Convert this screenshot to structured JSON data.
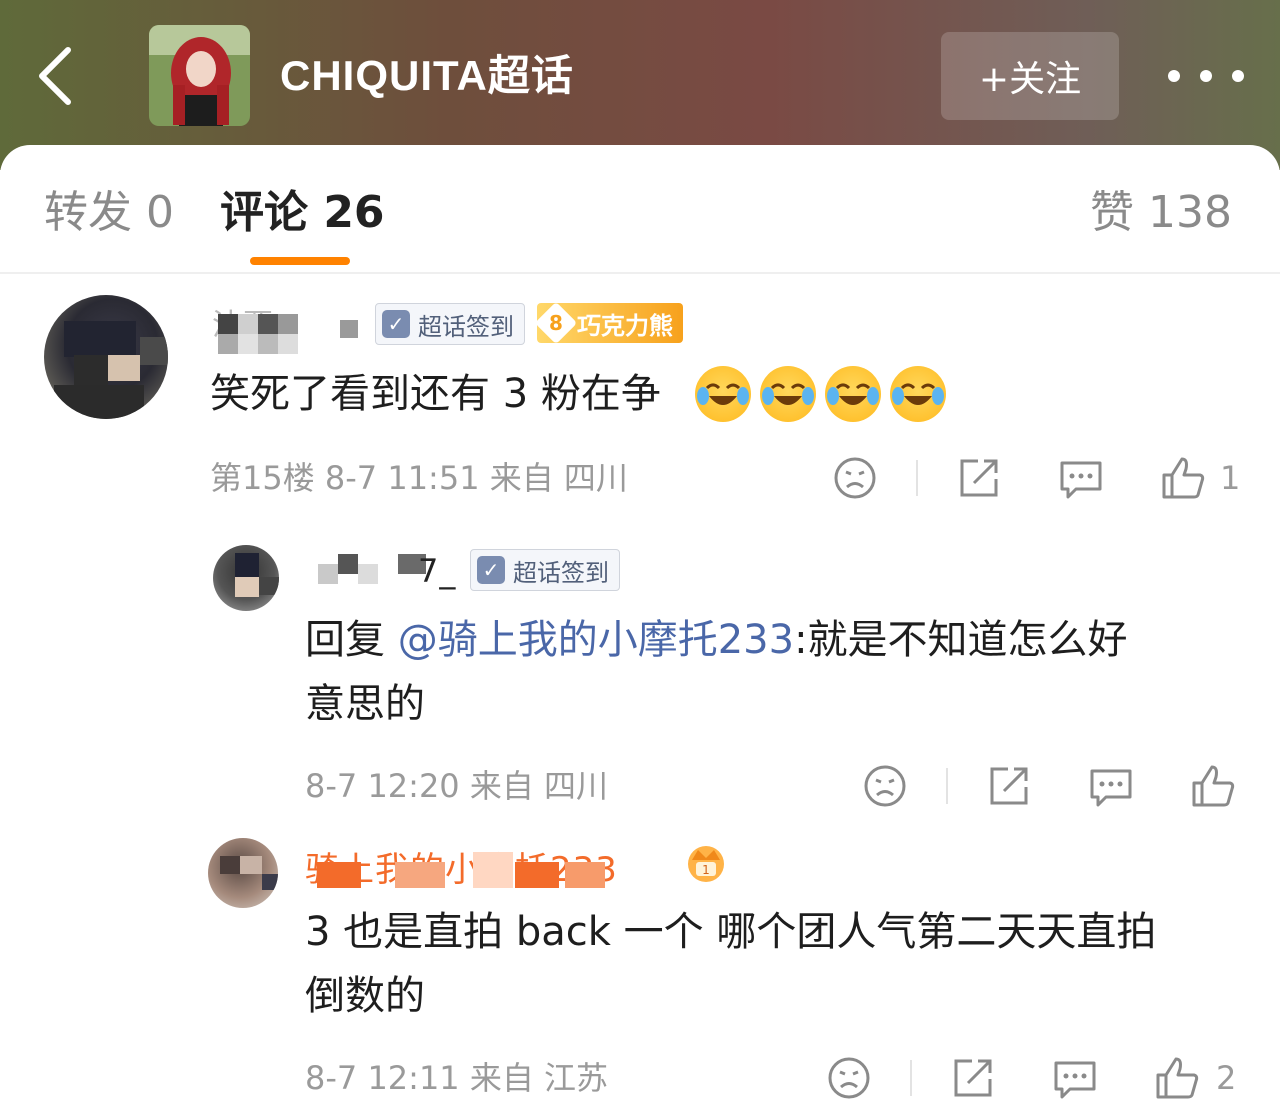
{
  "header": {
    "title": "CHIQUITA超话",
    "follow_label": "+关注",
    "back_icon": "back-arrow-icon",
    "more_icon": "more-dots-icon"
  },
  "tabs": {
    "repost": "转发 0",
    "comment": "评论 26",
    "like": "赞 138"
  },
  "colors": {
    "accent": "#ff8200",
    "mention": "#4a67a8",
    "username_highlight": "#f36b2a"
  },
  "comments": [
    {
      "username": "沫栗",
      "badges": {
        "checkin": "超话签到",
        "fan_level": "8",
        "fan_name": "巧克力熊"
      },
      "text": "笑死了看到还有 3 粉在争",
      "meta": "第15楼 8-7 11:51 来自 四川",
      "likes": "1"
    },
    {
      "username": "7_",
      "badges": {
        "checkin": "超话签到"
      },
      "reply_prefix": "回复 ",
      "mention": "@骑上我的小摩托233",
      "text_line1": ":就是不知道怎么好",
      "text_line2": "意思的",
      "meta": "8-7 12:20 来自 四川",
      "likes": ""
    },
    {
      "username": "骑上我的小摩托233",
      "text_line1": "3 也是直拍 back 一个 哪个团人气第二天天直拍",
      "text_line2": "倒数的",
      "meta": "8-7 12:11 来自 江苏",
      "likes": "2"
    }
  ]
}
